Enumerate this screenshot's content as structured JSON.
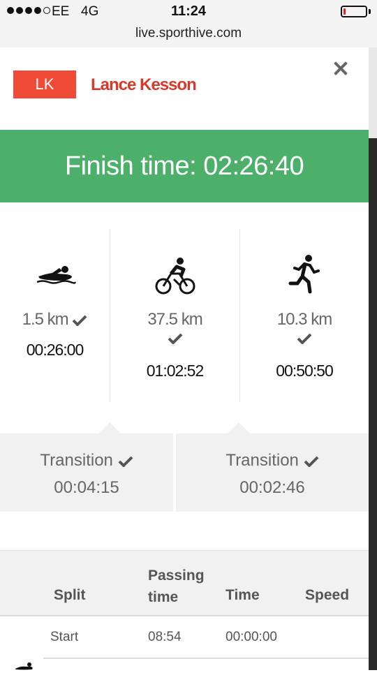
{
  "status_bar": {
    "signal_filled": 4,
    "signal_total": 5,
    "carrier": "EE",
    "network": "4G",
    "time": "11:24",
    "battery_color": "#e0242a"
  },
  "browser": {
    "url": "live.sporthive.com"
  },
  "athlete": {
    "initials": "LK",
    "name": "Lance Kesson",
    "badge_color": "#f04b36",
    "name_color": "#d8392b"
  },
  "close_icon": "close-icon",
  "finish": {
    "label": "Finish time: 02:26:40",
    "color": "#4cb06b"
  },
  "disciplines": [
    {
      "icon": "swim-icon",
      "distance": "1.5 km",
      "time": "00:26:00"
    },
    {
      "icon": "bike-icon",
      "distance": "37.5 km",
      "time": "01:02:52"
    },
    {
      "icon": "run-icon",
      "distance": "10.3 km",
      "time": "00:50:50"
    }
  ],
  "transitions": [
    {
      "label": "Transition",
      "time": "00:04:15"
    },
    {
      "label": "Transition",
      "time": "00:02:46"
    }
  ],
  "split_table": {
    "headers": {
      "split": "Split",
      "passing_line1": "Passing",
      "passing_line2": "time",
      "time": "Time",
      "speed": "Speed"
    },
    "rows": [
      {
        "split": "Start",
        "passing_time": "08:54",
        "time": "00:00:00"
      }
    ]
  }
}
